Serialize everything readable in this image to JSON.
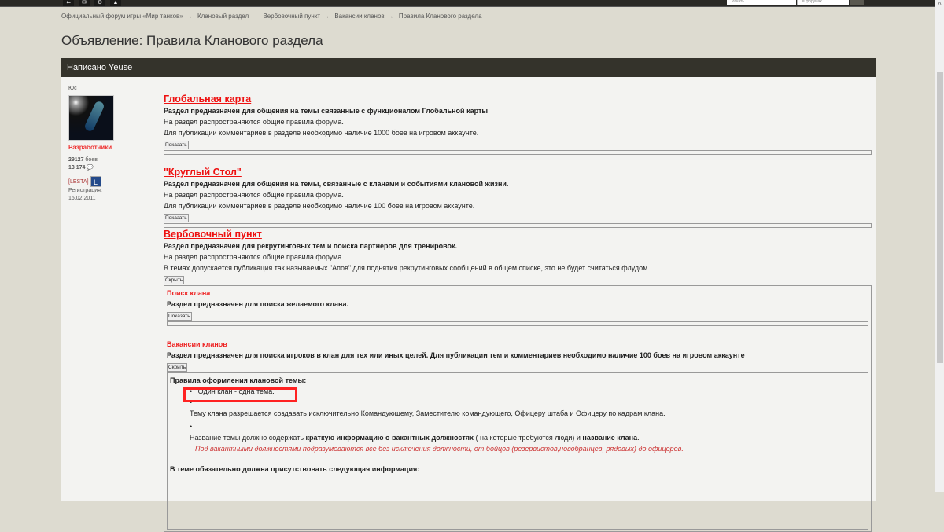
{
  "topbar": {
    "search_placeholder": "Искать...",
    "scope": "в форумах"
  },
  "breadcrumbs": [
    "Официальный форум игры «Мир танков»",
    "Клановый раздел",
    "Вербовочный пункт",
    "Вакансии кланов",
    "Правила Кланового раздела"
  ],
  "breadcrumb_sep": "→",
  "page_title": "Объявление: Правила Кланового раздела",
  "post": {
    "header": "Написано Yeuse",
    "user": {
      "name": "Юс",
      "group": "Разработчики",
      "battles_num": "29127",
      "battles_label": "боев",
      "posts": "13 174",
      "clan": "[LESTA]",
      "clan_badge": "L",
      "reg_label": "Регистрация:",
      "reg_date": "16.02.2011"
    },
    "sections": [
      {
        "title": "Глобальная карта",
        "desc": "Раздел предназначен для общения на темы связанные с функционалом Глобальной карты",
        "lines": [
          "На раздел распространяются общие правила форума.",
          "Для публикации комментариев в разделе необходимо наличие 1000 боев на игровом аккаунте."
        ],
        "button": "Показать"
      },
      {
        "title": "\"Круглый Стол\"",
        "desc": "Раздел предназначен для общения на темы, связанные с кланами и событиями клановой жизни.",
        "lines": [
          "На раздел распространяются общие правила форума.",
          "Для публикации комментариев в разделе необходимо наличие 100 боев на игровом аккаунте."
        ],
        "button": "Показать"
      },
      {
        "title": "Вербовочный пункт",
        "desc": "Раздел предназначен для рекрутинговых тем и поиска партнеров для тренировок.",
        "lines": [
          "На раздел распространяются общие правила форума.",
          "В темах допускается публикация так называемых \"Апов\" для поднятия рекрутинговых сообщений в общем списке, это не будет считаться флудом."
        ],
        "button": "Скрыть"
      }
    ],
    "sub": [
      {
        "title": "Поиск клана",
        "desc": "Раздел предназначен для поиска желаемого клана.",
        "button": "Показать"
      },
      {
        "title": "Вакансии кланов",
        "desc": "Раздел предназначен для поиска игроков в клан для тех или иных целей. Для публикации тем и комментариев необходимо наличие 100 боев на игровом аккаунте",
        "button": "Скрыть"
      }
    ],
    "rules": {
      "title": "Правила оформления клановой темы:",
      "item1": "Один клан - одна тема.",
      "item2": "Тему клана разрешается создавать исключительно Командующему, Заместителю командующего, Офицеру штаба и Офицеру по кадрам клана.",
      "item3_a": "Название темы должно содержать ",
      "item3_b": "краткую информацию о вакантных должностях",
      "item3_c": " ( на которые требуются люди) и ",
      "item3_d": "название клана",
      "item3_e": ".",
      "note": "Под вакантными должностями подразумеваются все без исключения должности, от бойцов (резервистов,новобранцев, рядовых) до офицеров.",
      "required": "В теме обязательно должна присутствовать следующая информация:"
    }
  }
}
